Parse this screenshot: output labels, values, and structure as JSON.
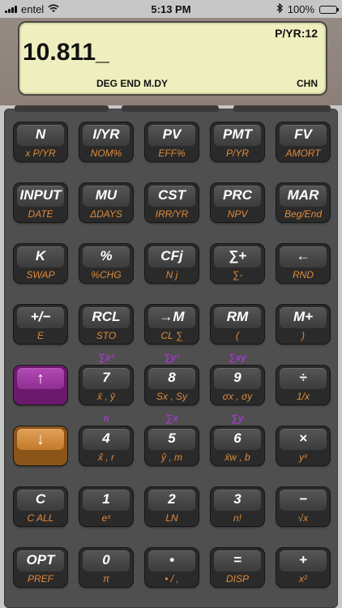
{
  "status_bar": {
    "carrier": "entel",
    "time": "5:13 PM",
    "battery": "100%"
  },
  "display": {
    "pyr": "P/YR:12",
    "value": "10.811_",
    "annunciators": "DEG  END  M.DY",
    "chn": "CHN"
  },
  "colors": {
    "shift_purple": "#a23ac9",
    "secondary_orange": "#e08a3c",
    "lcd": "#eeeebf"
  },
  "shift_labels": {
    "row5": [
      "∑x²",
      "∑y²",
      "∑xy"
    ],
    "row6": [
      "n",
      "∑x",
      "∑y"
    ]
  },
  "keys": [
    [
      {
        "main": "N",
        "sub": "x P/YR"
      },
      {
        "main": "I/YR",
        "sub": "NOM%"
      },
      {
        "main": "PV",
        "sub": "EFF%"
      },
      {
        "main": "PMT",
        "sub": "P/YR"
      },
      {
        "main": "FV",
        "sub": "AMORT"
      }
    ],
    [
      {
        "main": "INPUT",
        "sub": "DATE"
      },
      {
        "main": "MU",
        "sub": "ΔDAYS"
      },
      {
        "main": "CST",
        "sub": "IRR/YR"
      },
      {
        "main": "PRC",
        "sub": "NPV"
      },
      {
        "main": "MAR",
        "sub": "Beg/End"
      }
    ],
    [
      {
        "main": "K",
        "sub": "SWAP"
      },
      {
        "main": "%",
        "sub": "%CHG"
      },
      {
        "main": "CFj",
        "sub": "N j"
      },
      {
        "main": "∑+",
        "sub": "∑-"
      },
      {
        "main": "←",
        "sub": "RND"
      }
    ],
    [
      {
        "main": "+/−",
        "sub": "E"
      },
      {
        "main": "RCL",
        "sub": "STO"
      },
      {
        "main": "→M",
        "sub": "CL ∑"
      },
      {
        "main": "RM",
        "sub": "("
      },
      {
        "main": "M+",
        "sub": ")"
      }
    ],
    [
      {
        "main": "↑",
        "sub": "",
        "style": "purple"
      },
      {
        "main": "7",
        "sub": "x̄ , ȳ"
      },
      {
        "main": "8",
        "sub": "Sx , Sy"
      },
      {
        "main": "9",
        "sub": "σx , σy"
      },
      {
        "main": "÷",
        "sub": "1/x"
      }
    ],
    [
      {
        "main": "↓",
        "sub": "",
        "style": "orange"
      },
      {
        "main": "4",
        "sub": "x̂ , r"
      },
      {
        "main": "5",
        "sub": "ŷ , m"
      },
      {
        "main": "6",
        "sub": "x̄w , b"
      },
      {
        "main": "×",
        "sub": "yˣ"
      }
    ],
    [
      {
        "main": "C",
        "sub": "C ALL"
      },
      {
        "main": "1",
        "sub": "eˣ"
      },
      {
        "main": "2",
        "sub": "LN"
      },
      {
        "main": "3",
        "sub": "n!"
      },
      {
        "main": "−",
        "sub": "√x"
      }
    ],
    [
      {
        "main": "OPT",
        "sub": "PREF"
      },
      {
        "main": "0",
        "sub": "π"
      },
      {
        "main": "•",
        "sub": "• / ,"
      },
      {
        "main": "=",
        "sub": "DISP"
      },
      {
        "main": "+",
        "sub": "x²"
      }
    ]
  ]
}
